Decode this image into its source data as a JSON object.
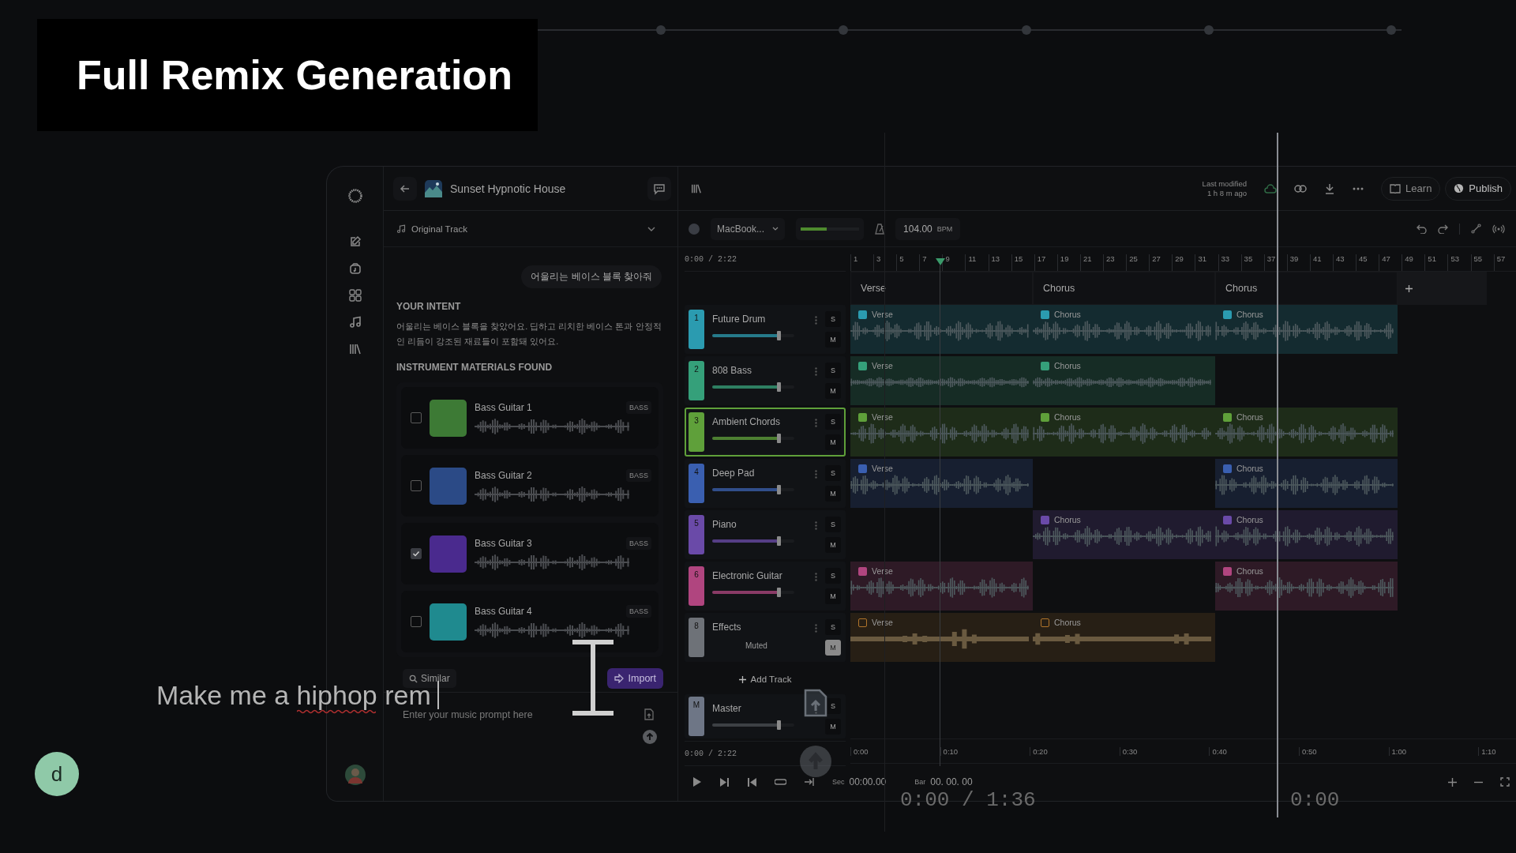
{
  "overlay_title": "Full Remix Generation",
  "project": {
    "title": "Sunset Hypnotic House",
    "last_modified_label": "Last modified",
    "last_modified_time": "1 h 8 m ago"
  },
  "header_buttons": [
    {
      "kind": "learn",
      "label": "Learn"
    },
    {
      "kind": "publish",
      "label": "Publish"
    }
  ],
  "chat": {
    "source": "Original Track",
    "user_message": "어울리는 베이스 블록 찾아줘",
    "intent_heading": "YOUR INTENT",
    "intent_text": "어울리는 베이스 블록을 찾았어요. 딥하고 리치한 베이스 톤과 안정적인 리듬이 강조된 재료들이 포함돼 있어요.",
    "materials_heading": "INSTRUMENT MATERIALS FOUND",
    "materials": [
      {
        "name": "Bass Guitar 1",
        "tag": "BASS",
        "checked": false,
        "color": "#3d7a35"
      },
      {
        "name": "Bass Guitar 2",
        "tag": "BASS",
        "checked": false,
        "color": "#2b4a86"
      },
      {
        "name": "Bass Guitar 3",
        "tag": "BASS",
        "checked": true,
        "color": "#4a2a8e"
      },
      {
        "name": "Bass Guitar 4",
        "tag": "BASS",
        "checked": false,
        "color": "#1f8a8f"
      }
    ],
    "similar": "Similar",
    "import": "Import",
    "prompt": {
      "placeholder": "Enter your music prompt here"
    }
  },
  "daw": {
    "device": "MacBook...",
    "input_meter": {
      "level": 0.45
    },
    "bpm": "104.00",
    "bpm_unit": "BPM",
    "time_top": "0:00 / 2:22",
    "bars": [
      "1",
      "3",
      "5",
      "7",
      "9",
      "11",
      "13",
      "15",
      "17",
      "19",
      "21",
      "23",
      "25",
      "27",
      "29",
      "31",
      "33",
      "35",
      "37",
      "39",
      "41",
      "43",
      "45",
      "47",
      "49",
      "51",
      "53",
      "55",
      "57"
    ],
    "sections": [
      {
        "label": "Verse"
      },
      {
        "label": "Chorus"
      },
      {
        "label": "Chorus"
      }
    ],
    "tracks": [
      {
        "number": "1",
        "name": "Future Drum",
        "color": "#2b9bb0",
        "level": 0.82,
        "muted": false,
        "selected": false,
        "solo_label": "S",
        "mute_label": "M",
        "clips": [
          {
            "kind": "clip",
            "label": "Verse",
            "color": "#2b9bb0"
          },
          {
            "kind": "clip",
            "label": "Chorus",
            "color": "#2b9bb0"
          },
          {
            "kind": "clip",
            "label": "Chorus",
            "color": "#2b9bb0"
          }
        ]
      },
      {
        "number": "2",
        "name": "808 Bass",
        "color": "#35a07a",
        "level": 0.82,
        "muted": false,
        "selected": false,
        "solo_label": "S",
        "mute_label": "M",
        "clips": [
          {
            "kind": "clip",
            "label": "Verse",
            "color": "#35a07a"
          },
          {
            "kind": "clip",
            "label": "Chorus",
            "color": "#35a07a"
          },
          {
            "kind": "empty"
          }
        ]
      },
      {
        "number": "3",
        "name": "Ambient Chords",
        "color": "#5fa03a",
        "level": 0.82,
        "muted": false,
        "selected": true,
        "solo_label": "S",
        "mute_label": "M",
        "clips": [
          {
            "kind": "clip",
            "label": "Verse",
            "color": "#5fa03a"
          },
          {
            "kind": "clip",
            "label": "Chorus",
            "color": "#5fa03a"
          },
          {
            "kind": "clip",
            "label": "Chorus",
            "color": "#5fa03a"
          }
        ]
      },
      {
        "number": "4",
        "name": "Deep Pad",
        "color": "#3a5fb0",
        "level": 0.82,
        "muted": false,
        "selected": false,
        "solo_label": "S",
        "mute_label": "M",
        "clips": [
          {
            "kind": "clip",
            "label": "Verse",
            "color": "#3a5fb0"
          },
          {
            "kind": "empty"
          },
          {
            "kind": "clip",
            "label": "Chorus",
            "color": "#3a5fb0"
          }
        ]
      },
      {
        "number": "5",
        "name": "Piano",
        "color": "#6a4aa8",
        "level": 0.82,
        "muted": false,
        "selected": false,
        "solo_label": "S",
        "mute_label": "M",
        "clips": [
          {
            "kind": "empty"
          },
          {
            "kind": "clip",
            "label": "Chorus",
            "color": "#6a4aa8"
          },
          {
            "kind": "clip",
            "label": "Chorus",
            "color": "#6a4aa8"
          }
        ]
      },
      {
        "number": "6",
        "name": "Electronic Guitar",
        "color": "#b0457f",
        "level": 0.82,
        "muted": false,
        "selected": false,
        "solo_label": "S",
        "mute_label": "M",
        "clips": [
          {
            "kind": "clip",
            "label": "Verse",
            "color": "#b0457f"
          },
          {
            "kind": "empty"
          },
          {
            "kind": "clip",
            "label": "Chorus",
            "color": "#b0457f"
          }
        ]
      },
      {
        "number": "8",
        "name": "Effects",
        "color": "#6e7278",
        "muted": true,
        "selected": false,
        "status": "Muted",
        "solo_label": "S",
        "mute_label": "M",
        "clips": [
          {
            "kind": "clip",
            "label": "Verse",
            "color": "#b0742a"
          },
          {
            "kind": "clip",
            "label": "Chorus",
            "color": "#b0742a"
          },
          {
            "kind": "empty"
          }
        ]
      }
    ],
    "add_track": "Add Track",
    "master": {
      "badge": "M",
      "name": "Master",
      "level": 0.82,
      "solo_label": "S",
      "mute_label": "M"
    },
    "time_bottom": "0:00 / 2:22",
    "times": [
      "0:00",
      "0:10",
      "0:20",
      "0:30",
      "0:40",
      "0:50",
      "1:00",
      "1:10"
    ],
    "transport": {
      "sec_label": "Sec",
      "sec": "00:00.00",
      "bar_label": "Bar",
      "bar": "00. 00. 00"
    }
  },
  "typed_prompt": "Make me a hiphop rem",
  "avatar_letter": "d",
  "video_time": "0:00 / 1:36",
  "video_time_right": "0:00"
}
